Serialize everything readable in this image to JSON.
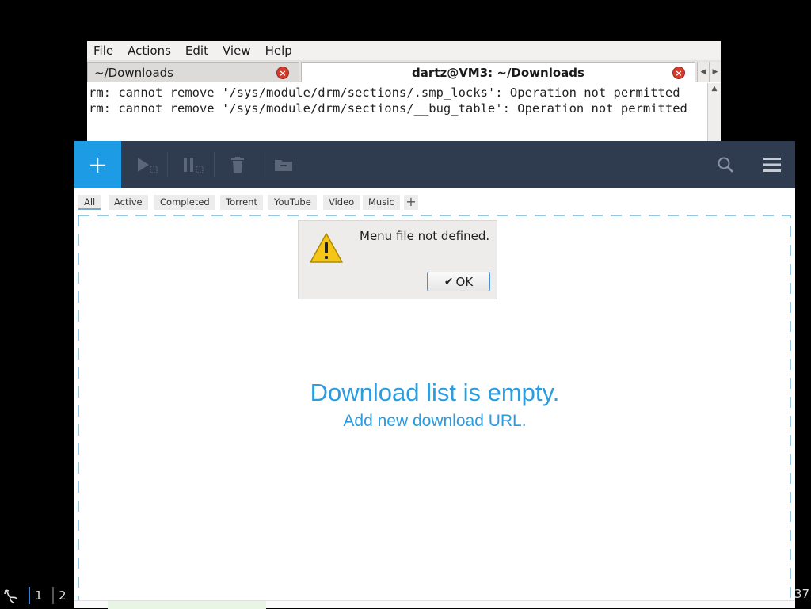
{
  "terminal": {
    "menu": [
      "File",
      "Actions",
      "Edit",
      "View",
      "Help"
    ],
    "tabs": [
      {
        "label": "~/Downloads",
        "active": false
      },
      {
        "label": "dartz@VM3: ~/Downloads",
        "active": true
      }
    ],
    "lines": [
      "rm: cannot remove '/sys/module/drm/sections/.smp_locks': Operation not permitted",
      "rm: cannot remove '/sys/module/drm/sections/__bug_table': Operation not permitted"
    ]
  },
  "download_manager": {
    "toolbar": {
      "add_label": "+",
      "icons": [
        "play-icon",
        "pause-icon",
        "trash-icon",
        "folder-icon",
        "search-icon",
        "hamburger-menu-icon"
      ]
    },
    "tabs": [
      "All",
      "Active",
      "Completed",
      "Torrent",
      "YouTube",
      "Video",
      "Music"
    ],
    "tab_add_label": "+",
    "empty_title": "Download list is empty.",
    "empty_subtitle": "Add new download URL.",
    "colors": {
      "toolbar_bg": "#2f3b4e",
      "accent": "#1d9be5",
      "empty_text": "#2a9ce0"
    }
  },
  "dialog": {
    "message": "Menu file not defined.",
    "ok_label": "OK",
    "icon": "warning-icon"
  },
  "taskbar": {
    "workspaces": [
      "1",
      "2"
    ],
    "clock": "37"
  }
}
